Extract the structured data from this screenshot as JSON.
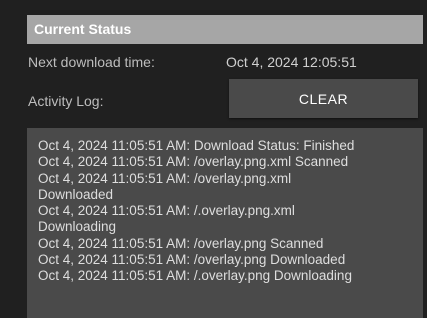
{
  "header": {
    "title": "Current Status"
  },
  "next_download": {
    "label": "Next download time:",
    "value": "Oct 4, 2024 12:05:51"
  },
  "activity": {
    "label": "Activity Log:",
    "clear_label": "CLEAR"
  },
  "log": {
    "lines": [
      "Oct 4, 2024 11:05:51 AM: Download Status: Finished",
      "Oct 4, 2024 11:05:51 AM: /overlay.png.xml Scanned",
      "Oct 4, 2024 11:05:51 AM: /overlay.png.xml",
      "Downloaded",
      "Oct 4, 2024 11:05:51 AM: /.overlay.png.xml",
      "Downloading",
      "Oct 4, 2024 11:05:51 AM: /overlay.png Scanned",
      "Oct 4, 2024 11:05:51 AM: /overlay.png Downloaded",
      "Oct 4, 2024 11:05:51 AM: /.overlay.png Downloading"
    ]
  },
  "colors": {
    "background": "#202020",
    "header_bar": "#a6a6a6",
    "panel": "#4a4a4a",
    "text": "#dedede"
  }
}
